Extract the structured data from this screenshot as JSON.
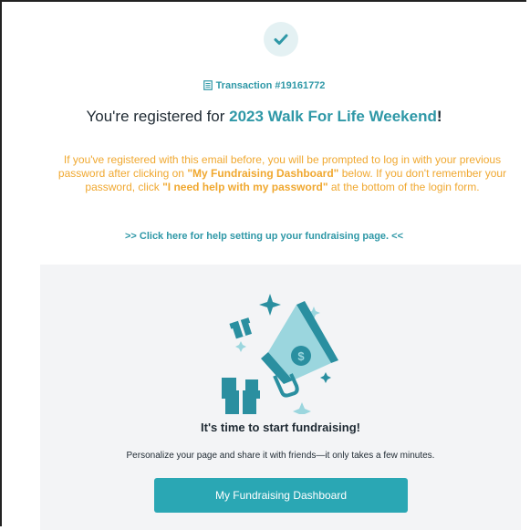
{
  "colors": {
    "accent": "#2f98a7",
    "warning": "#f0a830",
    "button": "#2aa7b4",
    "panel": "#f3f4f6"
  },
  "icons": {
    "success": "check-icon",
    "transaction": "document-icon",
    "illustration": "megaphone-gift-illustration"
  },
  "transaction": {
    "label": "Transaction #19161772"
  },
  "headline": {
    "prefix": "You're registered for ",
    "event": "2023 Walk For Life Weekend",
    "suffix": "!"
  },
  "notice": {
    "p1": "If you've registered with this email before, you will be prompted to log in with your previous password after clicking on ",
    "b1": "\"My Fundraising Dashboard\"",
    "p2": " below. If you don't remember your password, click ",
    "b2": "\"I need help with my password\"",
    "p3": " at the bottom of the login form."
  },
  "help_link": {
    "text": ">> Click here for help setting up your fundraising page. <<"
  },
  "panel": {
    "title": "It's time to start fundraising!",
    "subtitle": "Personalize your page and share it with friends—it only takes a few minutes.",
    "button_label": "My Fundraising Dashboard"
  }
}
